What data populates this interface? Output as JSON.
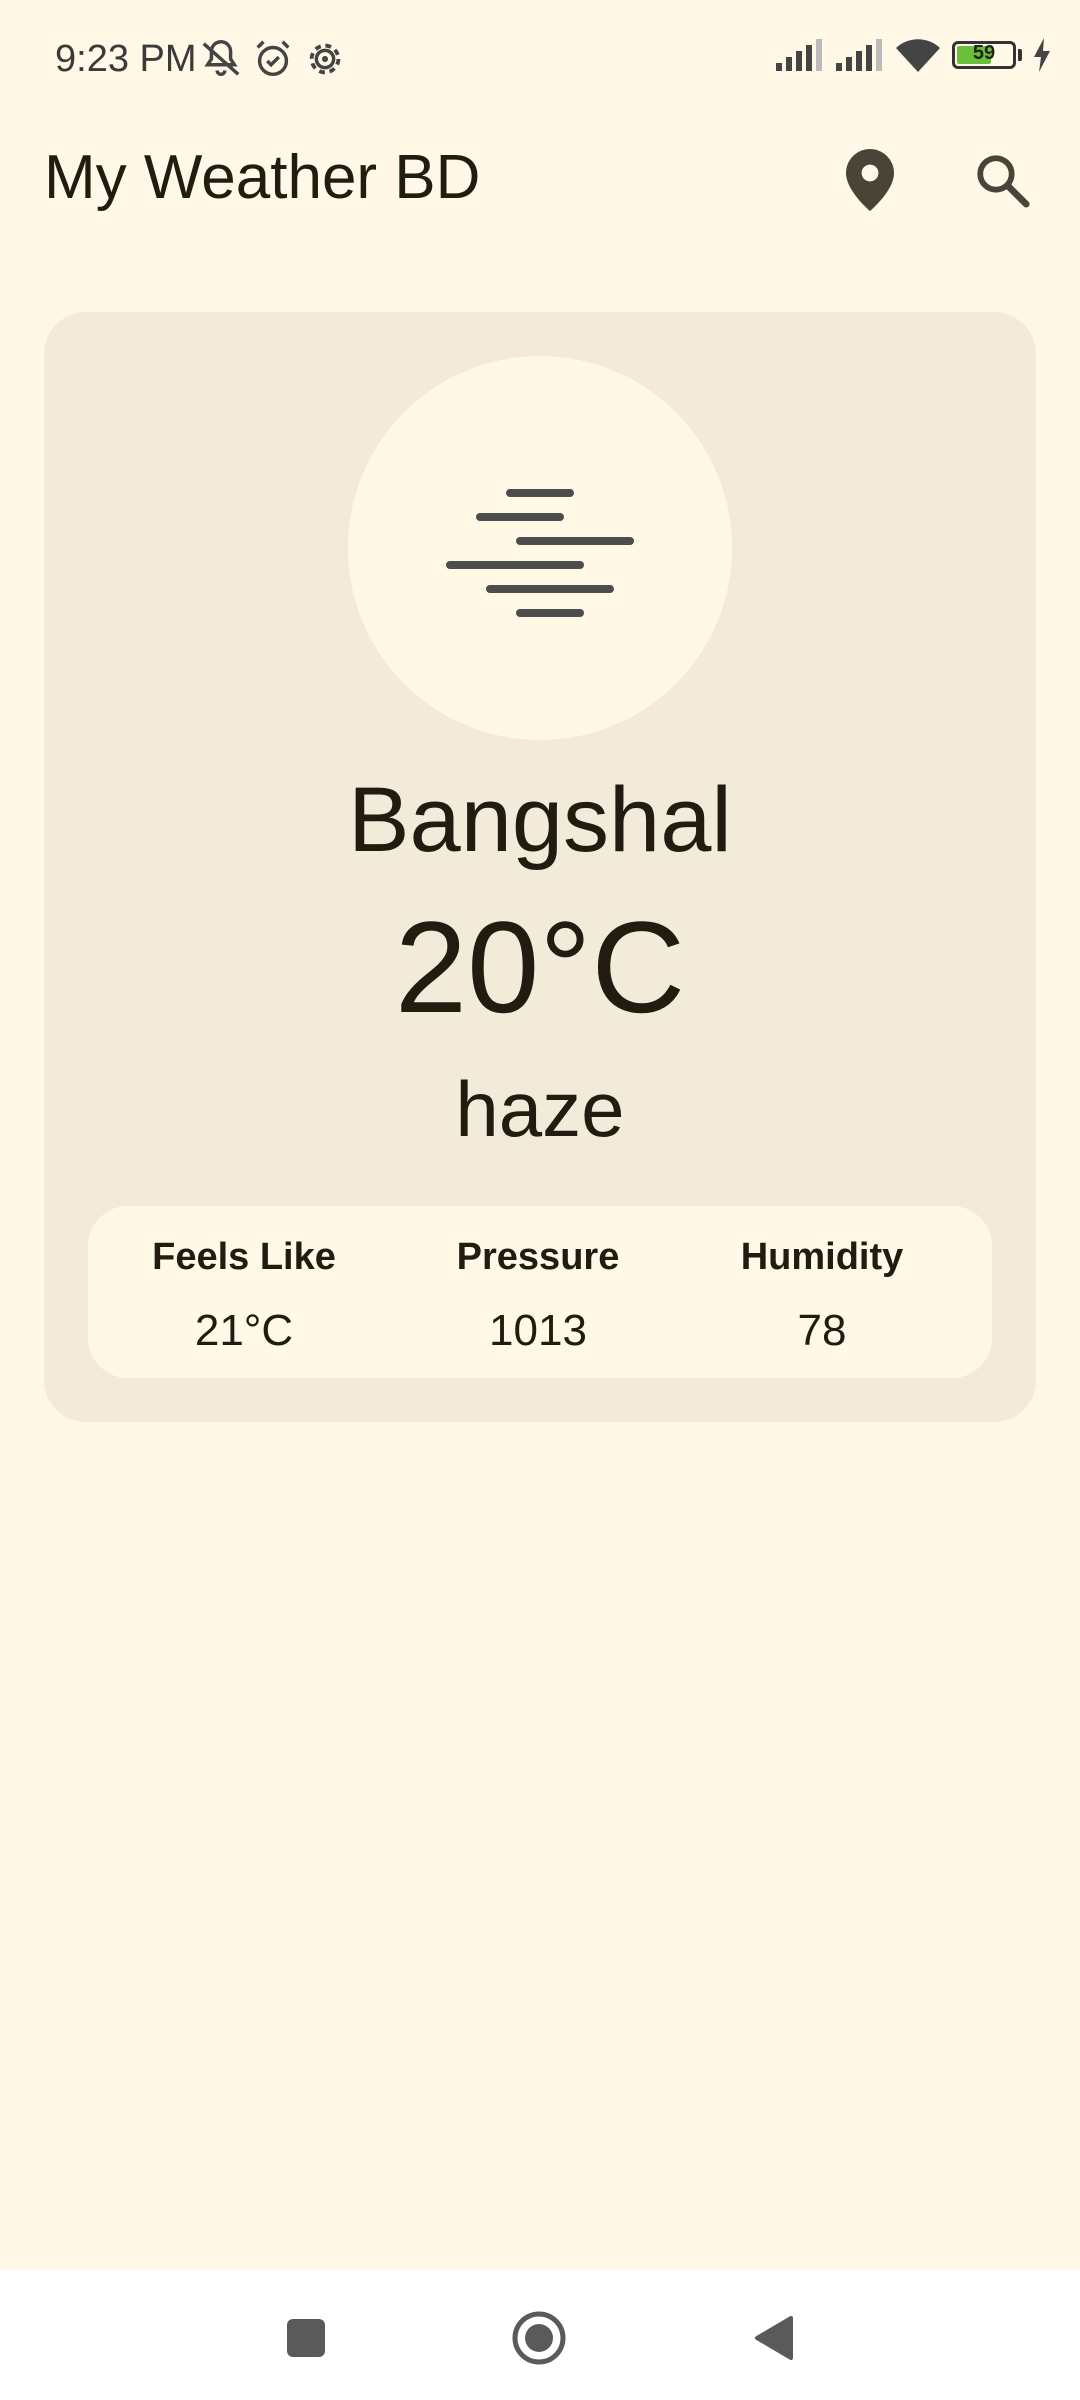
{
  "status_bar": {
    "time": "9:23 PM",
    "battery_level": "59",
    "icons": [
      "bell-off-icon",
      "alarm-icon",
      "settings-icon",
      "signal-icon",
      "signal-icon",
      "wifi-icon",
      "battery-icon",
      "charging-icon"
    ]
  },
  "app_bar": {
    "title": "My Weather BD",
    "actions": [
      "location-pin-icon",
      "search-icon"
    ]
  },
  "weather": {
    "icon": "haze-icon",
    "city": "Bangshal",
    "temperature": "20°C",
    "condition": "haze",
    "details": [
      {
        "label": "Feels Like",
        "value": "21°C"
      },
      {
        "label": "Pressure",
        "value": "1013"
      },
      {
        "label": "Humidity",
        "value": "78"
      }
    ]
  },
  "nav_bar": {
    "buttons": [
      "recents-icon",
      "home-icon",
      "back-icon"
    ]
  },
  "colors": {
    "background": "#FFF8E7",
    "card": "#F3EBD9",
    "text": "#221B10",
    "icon": "#4A4A4A",
    "battery": "#6BBF3A"
  }
}
